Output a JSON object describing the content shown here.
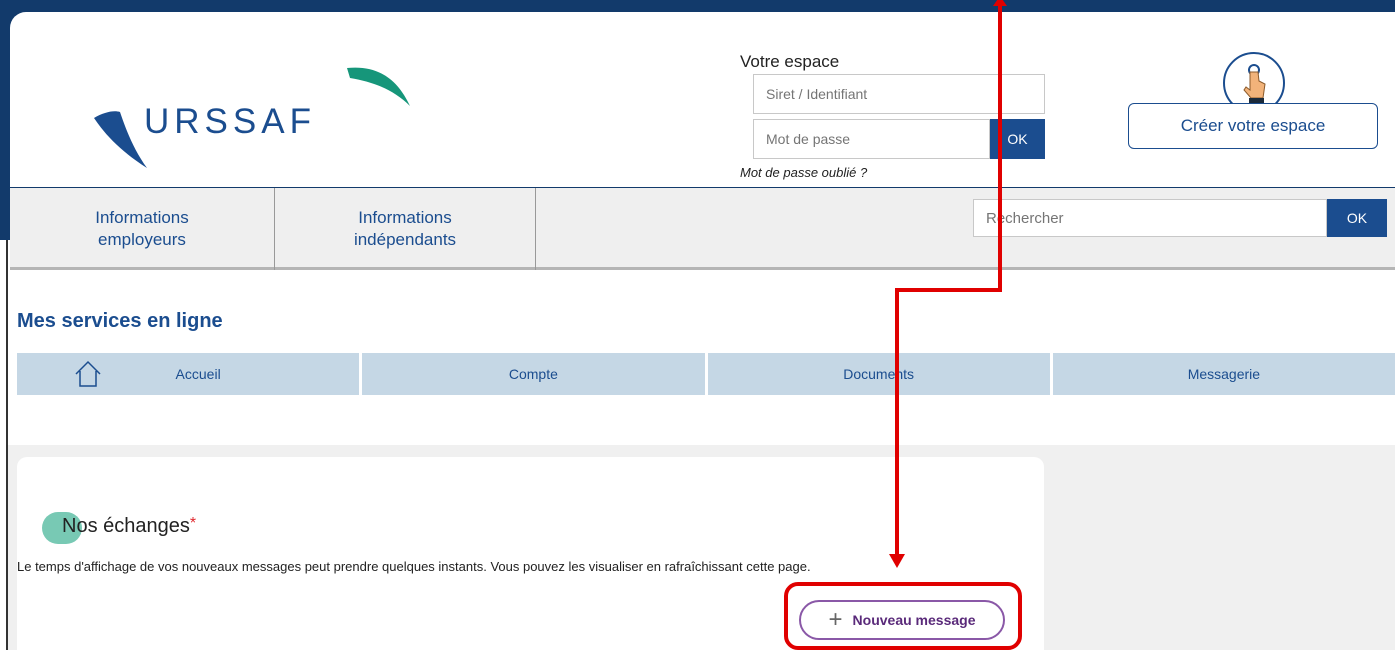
{
  "header": {
    "logo_text": "URSSAF",
    "login": {
      "title": "Votre espace",
      "id_placeholder": "Siret / Identifiant",
      "password_placeholder": "Mot de passe",
      "ok_label": "OK",
      "forgot_label": "Mot de passe oublié ?"
    },
    "create_label": "Créer votre espace"
  },
  "nav": {
    "items": [
      {
        "line1": "Informations",
        "line2": "employeurs"
      },
      {
        "line1": "Informations",
        "line2": "indépendants"
      }
    ],
    "search_placeholder": "Rechercher",
    "search_ok": "OK"
  },
  "services": {
    "title": "Mes services en ligne",
    "tabs": [
      "Accueil",
      "Compte",
      "Documents",
      "Messagerie"
    ]
  },
  "exchanges": {
    "title": "Nos échanges",
    "required_mark": "*",
    "description": "Le temps d'affichage de vos nouveaux messages peut prendre quelques instants. Vous pouvez les visualiser en rafraîchissant cette page.",
    "new_message_label": "Nouveau message"
  },
  "colors": {
    "brand_blue": "#1b4d8f",
    "brand_green": "#16967a",
    "tab_bg": "#c5d7e5",
    "annotation_red": "#e00000",
    "button_purple": "#8a58a7"
  }
}
